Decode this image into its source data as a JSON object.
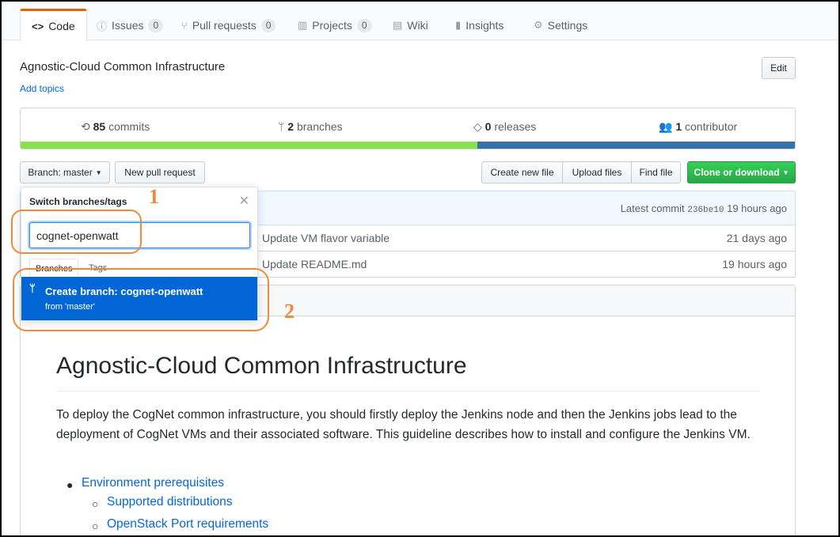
{
  "tabs": [
    {
      "label": "Code",
      "icon": "code-icon",
      "counter": null,
      "active": true
    },
    {
      "label": "Issues",
      "icon": "issue-icon",
      "counter": "0"
    },
    {
      "label": "Pull requests",
      "icon": "pull-request-icon",
      "counter": "0"
    },
    {
      "label": "Projects",
      "icon": "project-icon",
      "counter": "0"
    },
    {
      "label": "Wiki",
      "icon": "book-icon",
      "counter": null
    },
    {
      "label": "Insights",
      "icon": "graph-icon",
      "counter": null
    },
    {
      "label": "Settings",
      "icon": "gear-icon",
      "counter": null
    }
  ],
  "repo": {
    "description": "Agnostic-Cloud Common Infrastructure",
    "add_topics": "Add topics",
    "edit_label": "Edit"
  },
  "summary": {
    "commits_count": "85",
    "commits_label": "commits",
    "branches_count": "2",
    "branches_label": "branches",
    "releases_count": "0",
    "releases_label": "releases",
    "contributors_count": "1",
    "contributors_label": "contributor",
    "language_bar": [
      {
        "color": "#89e051",
        "fraction": 0.59
      },
      {
        "color": "#3572A5",
        "fraction": 0.41
      }
    ]
  },
  "toolbar": {
    "branch_label": "Branch: master",
    "new_pull_request": "New pull request",
    "create_new_file": "Create new file",
    "upload_files": "Upload files",
    "find_file": "Find file",
    "clone_or_download": "Clone or download"
  },
  "commit_bar": {
    "latest_commit_label": "Latest commit",
    "sha": "236be10",
    "time": "19 hours ago"
  },
  "files": [
    {
      "message": "Update VM flavor variable",
      "age": "21 days ago"
    },
    {
      "message": "Update README.md",
      "age": "19 hours ago"
    }
  ],
  "dropdown": {
    "title": "Switch branches/tags",
    "input_value": "cognet-openwatt",
    "tab_branches": "Branches",
    "tab_tags": "Tags",
    "create_label": "Create branch: cognet-openwatt",
    "create_from": "from 'master'"
  },
  "annotations": {
    "one": "1",
    "two": "2"
  },
  "readme": {
    "title": "Agnostic-Cloud Common Infrastructure",
    "paragraph": "To deploy the CogNet common infrastructure, you should firstly deploy the Jenkins node and then the Jenkins jobs lead to the deployment of CogNet VMs and their associated software. This guideline describes how to install and configure the Jenkins VM.",
    "list": [
      {
        "label": "Environment prerequisites",
        "level": 1
      },
      {
        "label": "Supported distributions",
        "level": 2
      },
      {
        "label": "OpenStack Port requirements",
        "level": 2
      }
    ]
  },
  "colors": {
    "accent": "#0366d6",
    "annotation": "#f0883e",
    "green": "#28a745"
  }
}
